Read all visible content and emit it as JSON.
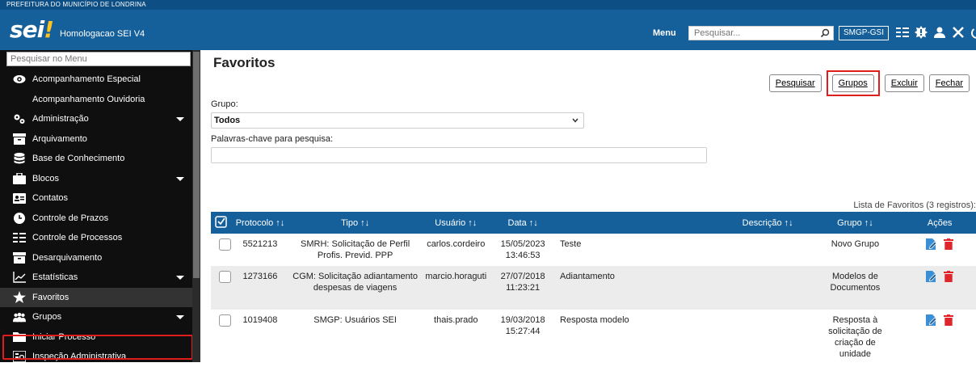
{
  "header": {
    "org": "PREFEITURA DO MUNICÍPIO DE LONDRINA",
    "logo": "sei",
    "logo_mark": "!",
    "system_name": "Homologacao SEI V4",
    "menu_label": "Menu",
    "search_placeholder": "Pesquisar...",
    "unit": "SMGP-GSI"
  },
  "sidebar": {
    "search_placeholder": "Pesquisar no Menu",
    "items": [
      {
        "label": "Acompanhamento Especial",
        "icon": "eye-icon"
      },
      {
        "label": "Acompanhamento Ouvidoria",
        "icon": ""
      },
      {
        "label": "Administração",
        "icon": "gears-icon",
        "has_submenu": true
      },
      {
        "label": "Arquivamento",
        "icon": "archive-icon"
      },
      {
        "label": "Base de Conhecimento",
        "icon": "database-icon"
      },
      {
        "label": "Blocos",
        "icon": "briefcase-icon",
        "has_submenu": true
      },
      {
        "label": "Contatos",
        "icon": "contact-card-icon"
      },
      {
        "label": "Controle de Prazos",
        "icon": "clock-icon"
      },
      {
        "label": "Controle de Processos",
        "icon": "list-icon"
      },
      {
        "label": "Desarquivamento",
        "icon": "unarchive-icon"
      },
      {
        "label": "Estatísticas",
        "icon": "chart-line-icon",
        "has_submenu": true
      },
      {
        "label": "Favoritos",
        "icon": "star-icon",
        "active": true
      },
      {
        "label": "Grupos",
        "icon": "users-icon",
        "has_submenu": true
      },
      {
        "label": "Iniciar Processo",
        "icon": "folder-icon"
      },
      {
        "label": "Inspeção Administrativa",
        "icon": "inspection-icon"
      }
    ]
  },
  "main": {
    "title": "Favoritos",
    "buttons": {
      "search": "Pesquisar",
      "groups": "Grupos",
      "delete": "Excluir",
      "close": "Fechar"
    },
    "group_label": "Grupo:",
    "group_value": "Todos",
    "keywords_label": "Palavras-chave para pesquisa:",
    "keywords_value": "",
    "list_caption": "Lista de Favoritos (3 registros):",
    "columns": [
      "Protocolo",
      "Tipo",
      "Usuário",
      "Data",
      "Descrição",
      "Grupo",
      "Ações"
    ],
    "rows": [
      {
        "protocolo": "5521213",
        "tipo": "SMRH: Solicitação de Perfil Profis. Previd. PPP",
        "usuario": "carlos.cordeiro",
        "data": "15/05/2023 13:46:53",
        "descricao": "Teste",
        "grupo": "Novo Grupo"
      },
      {
        "protocolo": "1273166",
        "tipo": "CGM: Solicitação adiantamento despesas de viagens",
        "usuario": "marcio.horaguti",
        "data": "27/07/2018 11:23:21",
        "descricao": "Adiantamento",
        "grupo": "Modelos de Documentos"
      },
      {
        "protocolo": "1019408",
        "tipo": "SMGP: Usuários SEI",
        "usuario": "thais.prado",
        "data": "19/03/2018 15:27:44",
        "descricao": "Resposta modelo",
        "grupo": "Resposta à solicitação de criação de unidade"
      }
    ]
  },
  "colors": {
    "header_blue": "#155f9a",
    "sidebar_bg": "#0f0f0f",
    "highlight_red": "#e01d1d",
    "action_blue": "#3a8fd6",
    "delete_red": "#e0262b"
  }
}
